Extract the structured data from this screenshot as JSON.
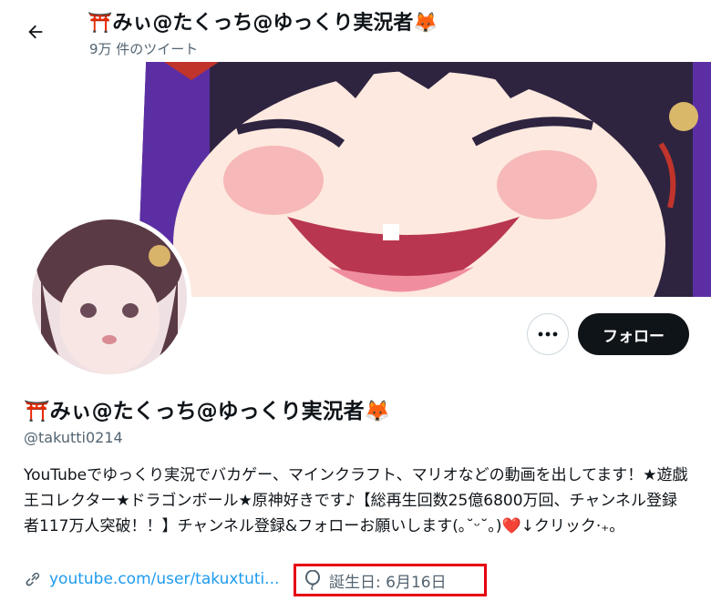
{
  "header": {
    "title": "⛩️みぃ@たくっち@ゆっくり実況者🦊",
    "tweet_count": "9万 件のツイート"
  },
  "actions": {
    "more_label": "•••",
    "follow_label": "フォロー"
  },
  "profile": {
    "display_name": "⛩️みぃ@たくっち@ゆっくり実況者🦊",
    "handle": "@takutti0214",
    "bio": "YouTubeでゆっくり実況でバカゲー、マインクラフト、マリオなどの動画を出してます！★遊戯王コレクター★ドラゴンボール★原神好きです♪【総再生回数25億6800万回、チャンネル登録者117万人突破！！】チャンネル登録&フォローお願いします(｡˘ᵕ˘｡)❤️↓クリック‧₊。",
    "link": "youtube.com/user/takuxtuti...",
    "birthday": "誕生日: 6月16日"
  },
  "colors": {
    "link": "#1d9bf0",
    "highlight_box": "#e60012",
    "follow_bg": "#0f1419"
  },
  "icons": {
    "back": "arrow-left-icon",
    "link": "link-icon",
    "birthday": "balloon-icon",
    "more": "ellipsis-icon"
  }
}
